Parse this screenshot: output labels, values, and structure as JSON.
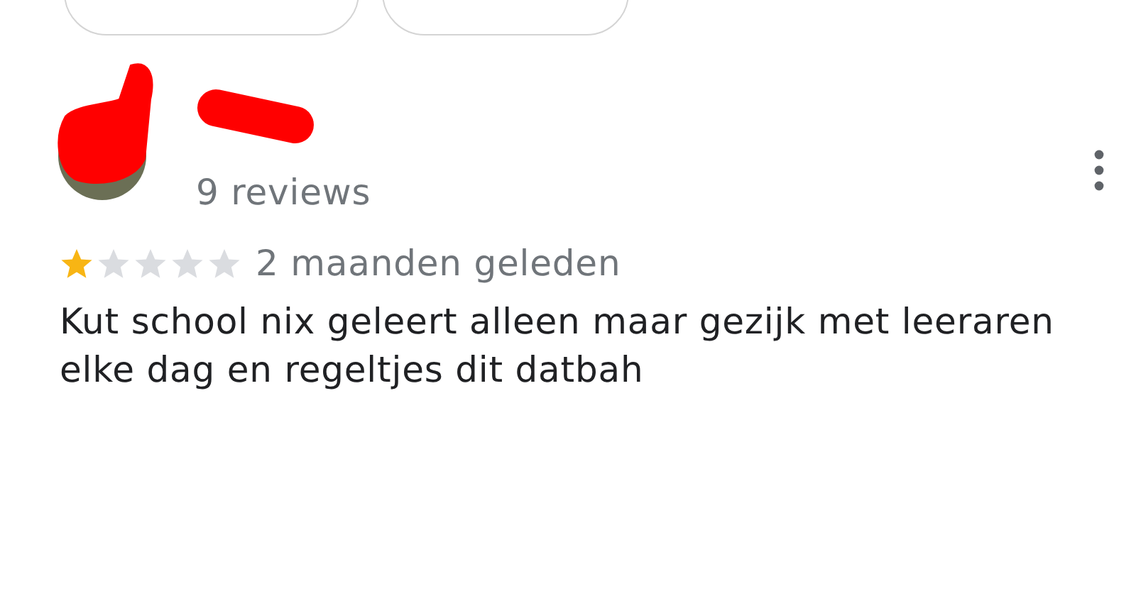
{
  "top_chips": [
    {
      "kind": "chip"
    },
    {
      "kind": "chip"
    }
  ],
  "reviewer": {
    "reviews": "9 reviews"
  },
  "review": {
    "stars": 1,
    "time": "2 maanden geleden",
    "text": "Kut school nix geleert alleen maar gezijk met leeraren elke dag en regeltjes dit datbah"
  }
}
